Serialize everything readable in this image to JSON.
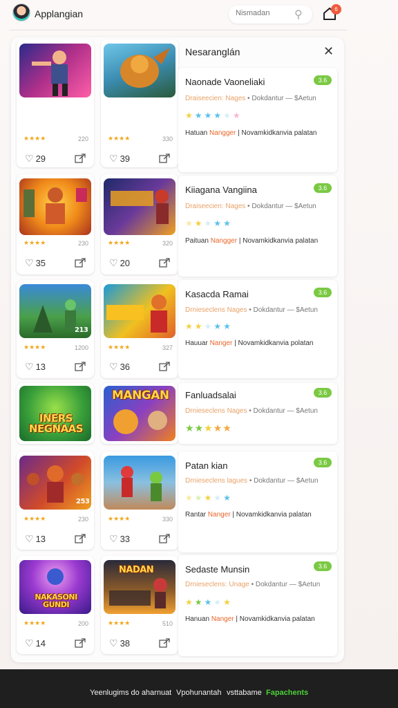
{
  "header": {
    "app_title": "Applangian",
    "search_placeholder": "Nismadan",
    "notification_count": "6"
  },
  "panel": {
    "title": "Nesaranglán"
  },
  "rows": [
    {
      "cards": [
        {
          "stars": "★★★★",
          "size": "220",
          "likes": "29"
        },
        {
          "stars": "★★★★",
          "size": "330",
          "likes": "39"
        }
      ],
      "detail": {
        "title": "Naonade Vaoneliaki",
        "badge": "3.6",
        "sub_orange": "Draiseecien: Nages",
        "sub_grey": " • Dokdantur — $Aetun",
        "desc_a": "Hatuan ",
        "desc_orange": "Nangger",
        "desc_b": " | Novamkidkanvia palatan"
      }
    },
    {
      "cards": [
        {
          "stars": "★★★★",
          "size": "230",
          "likes": "35"
        },
        {
          "stars": "★★★★",
          "size": "320",
          "likes": "20"
        }
      ],
      "detail": {
        "title": "Kiiagana Vangiina",
        "badge": "3.6",
        "sub_orange": "Draiseecien: Nages",
        "sub_grey": " • Dokdantur — $Aetun",
        "desc_a": "Paituan ",
        "desc_orange": "Nangger",
        "desc_b": " | Novamkidkanvia palatan"
      }
    },
    {
      "cards": [
        {
          "stars": "★★★★",
          "size": "1200",
          "likes": "13",
          "overlay": "213"
        },
        {
          "stars": "★★★★",
          "size": "327",
          "likes": "36"
        }
      ],
      "detail": {
        "title": "Kasacda Ramai",
        "badge": "3.6",
        "sub_orange": "Drnieseclens Nages",
        "sub_grey": " • Dokdantur — $Aetun",
        "desc_a": "Hauuar ",
        "desc_orange": "Nanger",
        "desc_b": " | Novamkidkanvia polatan"
      }
    },
    {
      "cards": [
        {
          "overlay": "INERS NEGNAAS"
        },
        {
          "overlay": "MANGAN"
        }
      ],
      "detail": {
        "title": "Fanluadsalai",
        "badge": "3.6",
        "sub_orange": "Drnieseclens Nages",
        "sub_grey": " • Dokdantur — $Aetun"
      }
    },
    {
      "cards": [
        {
          "stars": "★★★★",
          "size": "230",
          "likes": "13",
          "overlay": "253"
        },
        {
          "stars": "★★★★",
          "size": "330",
          "likes": "33"
        }
      ],
      "detail": {
        "title": "Patan kian",
        "badge": "3.6",
        "sub_orange": "Drnieseclens lagues",
        "sub_grey": " • Dokdantur — $Aetun",
        "desc_a": "Rantar ",
        "desc_orange": "Nanger",
        "desc_b": " | Novamkidkanvia palatan"
      }
    },
    {
      "cards": [
        {
          "stars": "★★★★",
          "size": "200",
          "likes": "14",
          "overlay": "NAKASONI GUNDI"
        },
        {
          "stars": "★★★★",
          "size": "510",
          "likes": "38",
          "overlay": "NADAN"
        }
      ],
      "detail": {
        "title": "Sedaste Munsin",
        "badge": "3.6",
        "sub_orange": "Drnieseclens: Unage",
        "sub_grey": " • Dokdantur — $Aetun",
        "desc_a": "Hanuan ",
        "desc_orange": "Nanger",
        "desc_b": " | Novamkidkanvia palatan"
      }
    }
  ],
  "footer": {
    "link1": "Yeenlugims do aharnuat",
    "link2": "Vpohunantah",
    "link3": "vsttabame",
    "link4": "Fapachents"
  },
  "colors": {
    "badge_green": "#7ac943",
    "star_gold": "#f2a61c",
    "accent_orange": "#e8662a",
    "footer_bg": "#1f1f1f",
    "footer_green": "#4cd137"
  },
  "icons": [
    "avatar",
    "search-icon",
    "home-icon",
    "close-icon",
    "heart-icon",
    "share-icon"
  ]
}
